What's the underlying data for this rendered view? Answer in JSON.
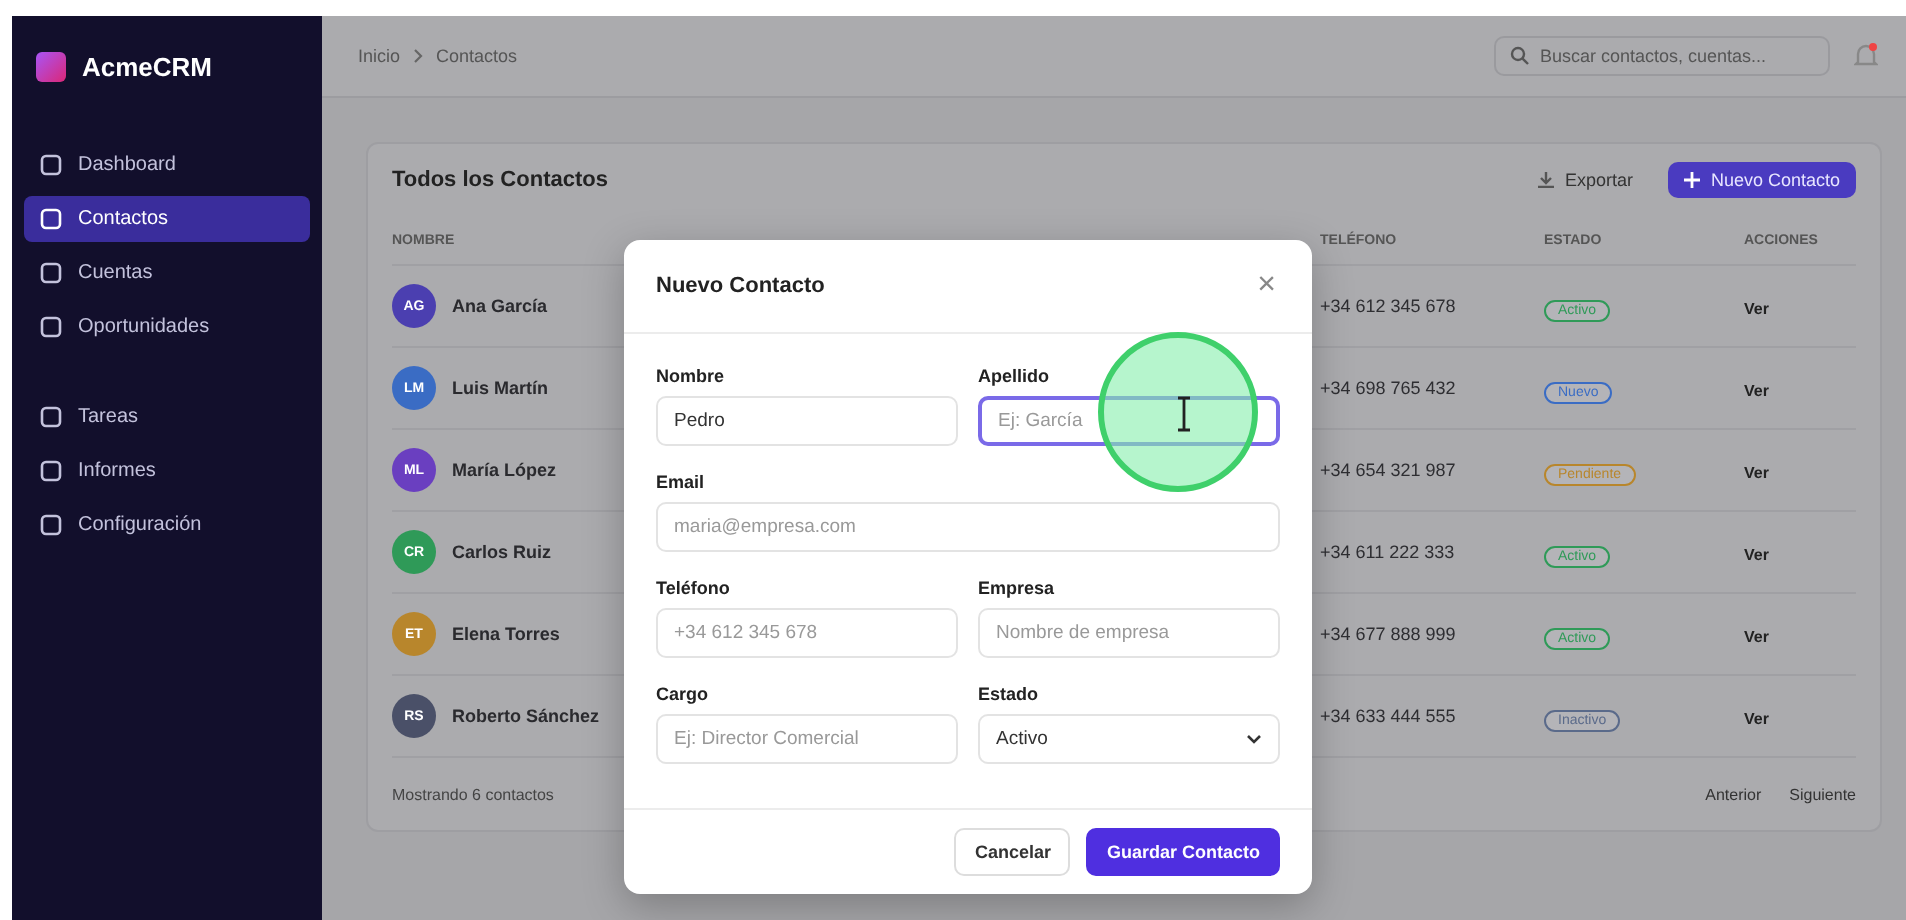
{
  "app": {
    "brand": "AcmeCRM"
  },
  "sidebar": {
    "groups": [
      {
        "items": [
          {
            "label": "Dashboard",
            "selected": false
          },
          {
            "label": "Contactos",
            "selected": true
          },
          {
            "label": "Cuentas",
            "selected": false
          },
          {
            "label": "Oportunidades",
            "selected": false
          }
        ]
      },
      {
        "items": [
          {
            "label": "Tareas",
            "selected": false
          },
          {
            "label": "Informes",
            "selected": false
          },
          {
            "label": "Configuración",
            "selected": false
          }
        ]
      }
    ]
  },
  "topbar": {
    "breadcrumb": [
      "Inicio",
      "Contactos"
    ],
    "search": {
      "placeholder": "Buscar contactos, cuentas..."
    }
  },
  "card": {
    "title": "Todos los Contactos",
    "buttons": [
      {
        "label": "Exportar",
        "kind": "secondary"
      },
      {
        "label": "Nuevo Contacto",
        "kind": "primary"
      }
    ]
  },
  "table": {
    "columns": [
      "NOMBRE",
      "TELÉFONO",
      "ESTADO",
      "ACCIONES"
    ],
    "rows": [
      {
        "initials": "AG",
        "name": "Ana García",
        "color": "#4b3fb0",
        "phone": "+34 612 345 678",
        "status": {
          "label": "Activo",
          "color": "#2f9a58"
        },
        "action": "Ver"
      },
      {
        "initials": "LM",
        "name": "Luis Martín",
        "color": "#3a6cc4",
        "phone": "+34 698 765 432",
        "status": {
          "label": "Nuevo",
          "color": "#3a6cc4"
        },
        "action": "Ver"
      },
      {
        "initials": "ML",
        "name": "María López",
        "color": "#6a3fc0",
        "phone": "+34 654 321 987",
        "status": {
          "label": "Pendiente",
          "color": "#b8862c"
        },
        "action": "Ver"
      },
      {
        "initials": "CR",
        "name": "Carlos Ruiz",
        "color": "#2f9a58",
        "phone": "+34 611 222 333",
        "status": {
          "label": "Activo",
          "color": "#2f9a58"
        },
        "action": "Ver"
      },
      {
        "initials": "ET",
        "name": "Elena Torres",
        "color": "#b8862c",
        "phone": "+34 677 888 999",
        "status": {
          "label": "Activo",
          "color": "#2f9a58"
        },
        "action": "Ver"
      },
      {
        "initials": "RS",
        "name": "Roberto Sánchez",
        "color": "#4a5068",
        "phone": "+34 633 444 555",
        "status": {
          "label": "Inactivo",
          "color": "#5a6a8a"
        },
        "action": "Ver"
      }
    ]
  },
  "footer": {
    "summary": "Mostrando 6 contactos",
    "pager": [
      "Anterior",
      "Siguiente"
    ]
  },
  "modal": {
    "title": "Nuevo Contacto",
    "close": "×",
    "rows": [
      {
        "fields": [
          {
            "label": "Nombre",
            "kind": "text",
            "value": "Pedro",
            "focused": false
          },
          {
            "label": "Apellido",
            "kind": "text",
            "placeholder": "Ej: García",
            "focused": true
          }
        ]
      },
      {
        "fields": [
          {
            "label": "Email",
            "kind": "text",
            "placeholder": "maria@empresa.com",
            "focused": false
          }
        ]
      },
      {
        "fields": [
          {
            "label": "Teléfono",
            "kind": "text",
            "placeholder": "+34 612 345 678",
            "focused": false
          },
          {
            "label": "Empresa",
            "kind": "text",
            "placeholder": "Nombre de empresa",
            "focused": false
          }
        ]
      },
      {
        "fields": [
          {
            "label": "Cargo",
            "kind": "text",
            "placeholder": "Ej: Director Comercial",
            "focused": false
          },
          {
            "label": "Estado",
            "kind": "select",
            "value": "Activo",
            "focused": false
          }
        ]
      }
    ],
    "buttons": [
      {
        "label": "Cancelar",
        "kind": "secondary"
      },
      {
        "label": "Guardar Contacto",
        "kind": "primary"
      }
    ]
  }
}
